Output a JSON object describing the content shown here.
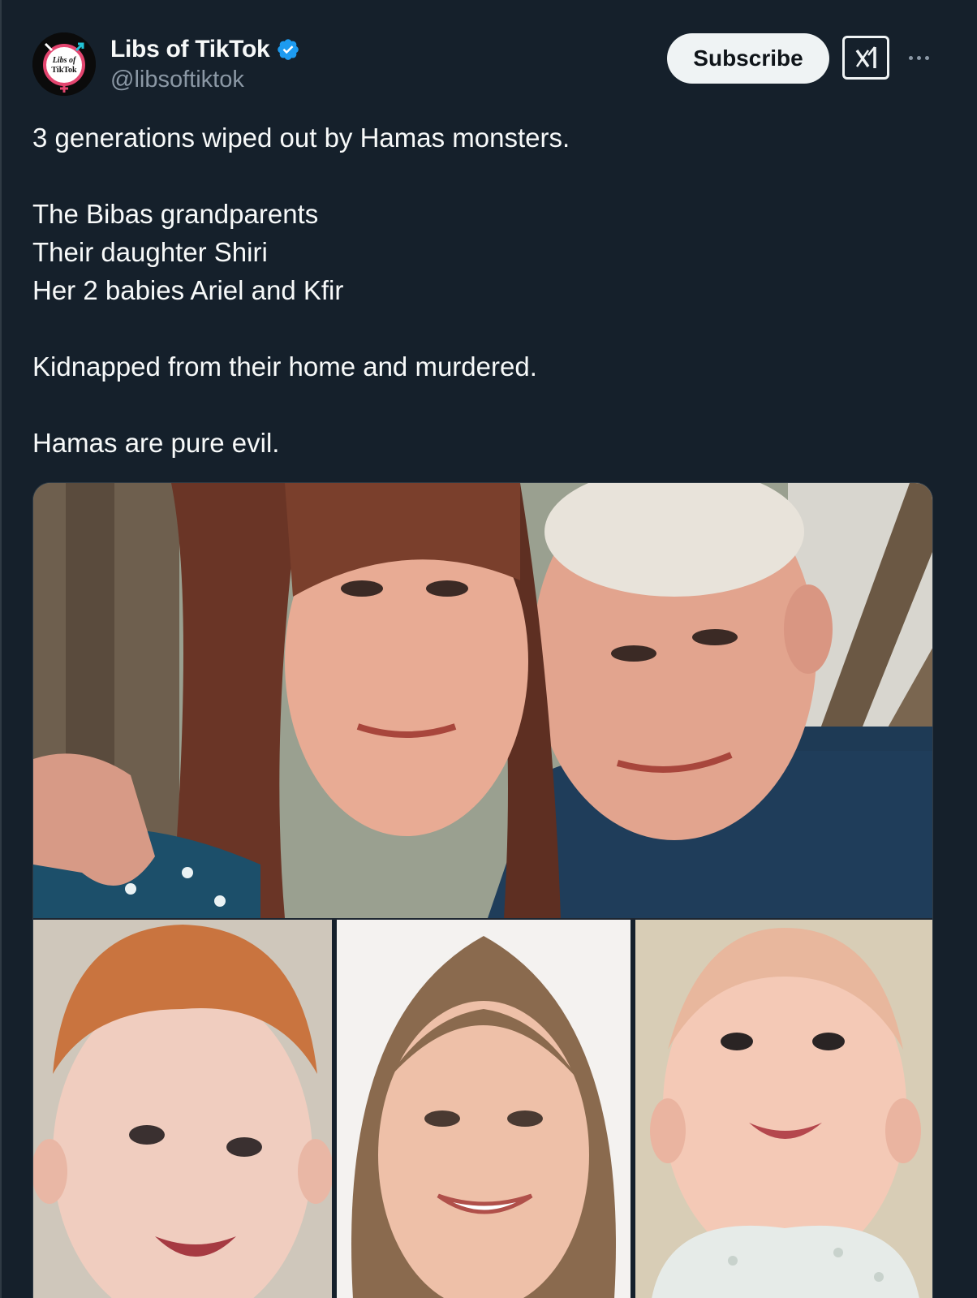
{
  "author": {
    "display_name": "Libs of TikTok",
    "handle": "@libsoftiktok",
    "avatar_text_line1": "Libs of",
    "avatar_text_line2": "TikTok",
    "verified": true
  },
  "actions": {
    "subscribe_label": "Subscribe",
    "grok_icon": "grok-icon",
    "more_icon": "more-icon"
  },
  "tweet": {
    "line1": "3 generations wiped out by Hamas monsters.",
    "line2": "The Bibas grandparents",
    "line3": "Their daughter Shiri",
    "line4": "Her 2 babies Ariel and Kfir",
    "line5": "Kidnapped from their home and murdered.",
    "line6": "Hamas are pure evil."
  },
  "media": {
    "photos": [
      "grandparents-photo",
      "boy-photo",
      "woman-photo",
      "baby-photo"
    ]
  },
  "colors": {
    "background": "#15202b",
    "text": "#f7f9f9",
    "secondary": "#8b98a5",
    "verified": "#1d9bf0"
  }
}
